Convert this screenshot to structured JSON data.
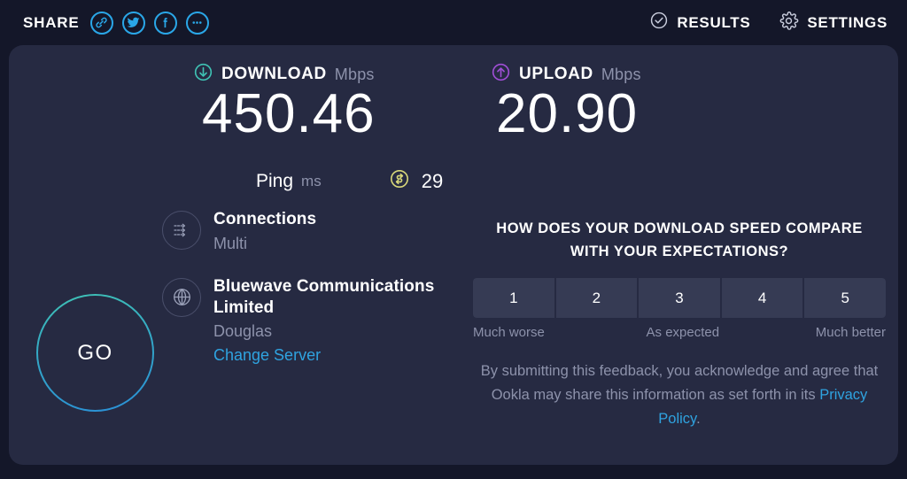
{
  "header": {
    "share_label": "SHARE",
    "share_icons": [
      {
        "name": "link-icon"
      },
      {
        "name": "twitter-icon"
      },
      {
        "name": "facebook-icon"
      },
      {
        "name": "more-icon"
      }
    ],
    "results_label": "RESULTS",
    "results_icon": "check-circle-icon",
    "settings_label": "SETTINGS",
    "settings_icon": "gear-icon"
  },
  "speeds": {
    "download": {
      "kind": "DOWNLOAD",
      "unit": "Mbps",
      "value": "450.46",
      "icon": "download-arrow-icon",
      "color": "#3fc2b4"
    },
    "upload": {
      "kind": "UPLOAD",
      "unit": "Mbps",
      "value": "20.90",
      "icon": "upload-arrow-icon",
      "color": "#a04ed6"
    }
  },
  "ping": {
    "label": "Ping",
    "unit": "ms",
    "value": "29",
    "icon": "latency-icon",
    "color": "#d9d87a"
  },
  "go_button": {
    "label": "GO"
  },
  "connection": {
    "title": "Connections",
    "value": "Multi",
    "icon": "connections-icon"
  },
  "server": {
    "isp": "Bluewave Communications Limited",
    "location": "Douglas",
    "change_link": "Change Server",
    "icon": "globe-icon"
  },
  "feedback": {
    "question": "HOW DOES YOUR DOWNLOAD SPEED COMPARE WITH YOUR EXPECTATIONS?",
    "options": [
      "1",
      "2",
      "3",
      "4",
      "5"
    ],
    "legend_low": "Much worse",
    "legend_mid": "As expected",
    "legend_high": "Much better",
    "disclaimer_before": "By submitting this feedback, you acknowledge and agree that Ookla may share this information as set forth in its ",
    "disclaimer_link": "Privacy Policy",
    "disclaimer_after": "."
  },
  "colors": {
    "page_background": "#141729",
    "panel_background": "#262a42",
    "accent_blue": "#2fa3e0",
    "muted_text": "#8d92ab",
    "scale_button": "#363b54"
  }
}
